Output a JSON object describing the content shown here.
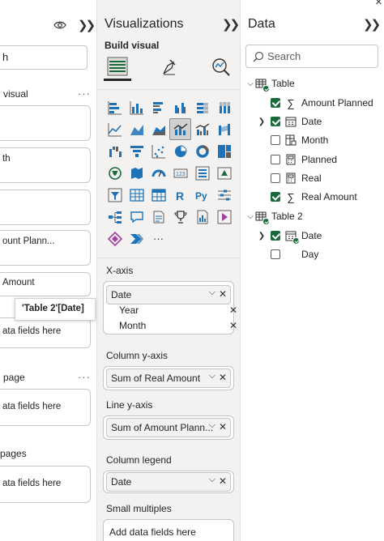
{
  "left_pane": {
    "input_value": "h",
    "section1_label": "visual",
    "cards": [
      {
        "text": ""
      },
      {
        "text": "th"
      },
      {
        "text": ""
      },
      {
        "text": "ount Plann..."
      },
      {
        "text": "Amount"
      }
    ],
    "add_field_1": "ata fields here",
    "section2_label": "page",
    "add_field_2": "ata fields here",
    "section3_label": "pages",
    "add_field_3": "ata fields here",
    "more": "···"
  },
  "tooltip": "'Table 2'[Date]",
  "visualizations": {
    "title": "Visualizations",
    "build_visual": "Build visual",
    "x_axis": {
      "label": "X-axis",
      "field": "Date",
      "sub_fields": [
        "Year",
        "Month"
      ]
    },
    "column_y_axis": {
      "label": "Column y-axis",
      "field": "Sum of Real Amount"
    },
    "line_y_axis": {
      "label": "Line y-axis",
      "field": "Sum of Amount Plann..."
    },
    "column_legend": {
      "label": "Column legend",
      "field": "Date"
    },
    "small_multiples": {
      "label": "Small multiples",
      "placeholder": "Add data fields here"
    },
    "more_visuals": "···"
  },
  "data": {
    "title": "Data",
    "search_placeholder": "Search",
    "tables": [
      {
        "name": "Table",
        "fields": [
          {
            "name": "Amount Planned",
            "checked": true,
            "icon": "sigma-icon"
          },
          {
            "name": "Date",
            "checked": true,
            "icon": "calendar-icon",
            "expandable": true
          },
          {
            "name": "Month",
            "checked": false,
            "icon": "calculated-column-icon"
          },
          {
            "name": "Planned",
            "checked": false,
            "icon": "calculator-icon"
          },
          {
            "name": "Real",
            "checked": false,
            "icon": "calculator-icon"
          },
          {
            "name": "Real Amount",
            "checked": true,
            "icon": "sigma-icon"
          }
        ]
      },
      {
        "name": "Table 2",
        "fields": [
          {
            "name": "Date",
            "checked": true,
            "icon": "calendar-icon",
            "expandable": true
          },
          {
            "name": "Day",
            "checked": false,
            "icon": "none"
          }
        ]
      }
    ]
  },
  "colors": {
    "accent_green": "#1b6b3a",
    "pane_gray": "#f3f2f1",
    "viz_blue": "#1e72b8",
    "viz_yellow": "#f2c811",
    "viz_purple": "#a33ea1"
  }
}
